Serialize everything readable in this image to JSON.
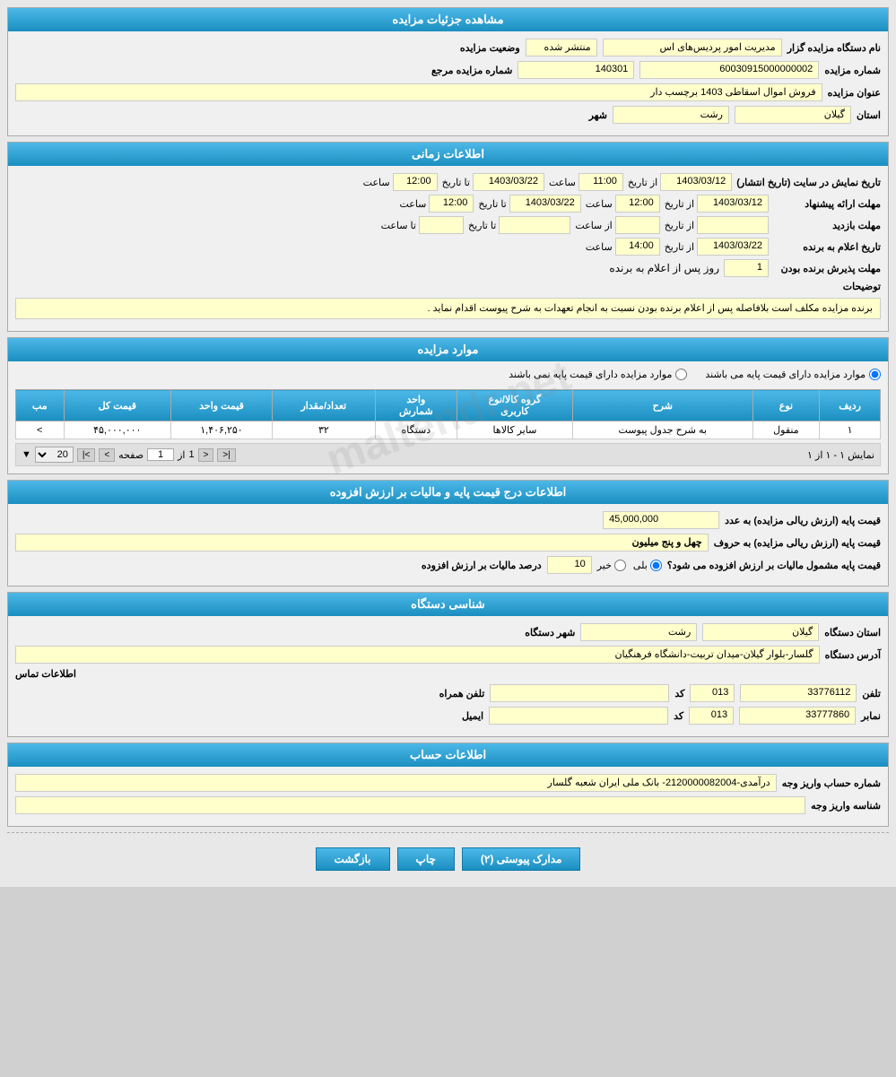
{
  "sections": {
    "auction_details": {
      "title": "مشاهده جزئیات مزایده",
      "fields": {
        "org_name_label": "نام دستگاه مزایده گزار",
        "org_name_value": "مدیریت امور پردیس‌های اس",
        "status_label": "وضعیت مزایده",
        "status_value": "منتشر شده",
        "auction_num_label": "شماره مزایده",
        "auction_num_value": "60030915000000002",
        "ref_num_label": "شماره مزایده مرجع",
        "ref_num_value": "140301",
        "title_label": "عنوان مزایده",
        "title_value": "فروش اموال اسقاطی 1403 برچسب دار",
        "province_label": "استان",
        "province_value": "گیلان",
        "city_label": "شهر",
        "city_value": "رشت"
      }
    },
    "time_info": {
      "title": "اطلاعات زمانی",
      "rows": [
        {
          "label": "تاریخ نمایش در سایت (تاریخ انتشار)",
          "from_date": "1403/03/12",
          "from_time": "11:00",
          "to_date": "1403/03/22",
          "to_time": "12:00"
        },
        {
          "label": "مهلت ارائه پیشنهاد",
          "from_date": "1403/03/12",
          "from_time": "12:00",
          "to_date": "1403/03/22",
          "to_time": "12:00"
        },
        {
          "label": "مهلت بازدید",
          "from_date": "",
          "from_time": "",
          "to_date": "",
          "to_time": ""
        },
        {
          "label": "تاریخ اعلام به برنده",
          "from_date": "1403/03/22",
          "from_time": "14:00",
          "to_date": "",
          "to_time": ""
        }
      ],
      "winner_days_label": "مهلت پذیرش برنده بودن",
      "winner_days_suffix": "روز پس از اعلام به برنده",
      "winner_days_value": "1",
      "desc_label": "توضیحات",
      "desc_value": "برنده مزایده مکلف است بلافاصله پس از اعلام برنده بودن نسبت به انجام تعهدات به شرح پیوست اقدام نماید ."
    },
    "moared": {
      "title": "موارد مزایده",
      "radio1": "موارد مزایده دارای قیمت پایه می باشند",
      "radio2": "موارد مزایده دارای قیمت پایه نمی باشند",
      "table": {
        "headers": [
          "ردیف",
          "نوع",
          "شرح",
          "گروه کالا/نوع کاربری",
          "واحد شمارش",
          "تعداد/مقدار",
          "قیمت واحد",
          "قیمت کل",
          "مبل"
        ],
        "rows": [
          {
            "row": "۱",
            "type": "منقول",
            "desc": "به شرح جدول پیوست",
            "group": "سایر کالاها",
            "unit": "دستگاه",
            "qty": "۳۲",
            "unit_price": "۱,۴۰۶,۲۵۰",
            "total": "۴۵,۰۰۰,۰۰۰",
            "extra": ">"
          }
        ]
      },
      "pager": {
        "show_label": "نمایش ۱ - ۱ از ۱",
        "page_label": "صفحه",
        "page_num": "1",
        "of_label": "از",
        "total_pages": "1",
        "per_page": "20"
      }
    },
    "price_info": {
      "title": "اطلاعات درج قیمت پایه و مالیات بر ارزش افزوده",
      "base_price_label": "قیمت پایه (ارزش ریالی مزایده) به عدد",
      "base_price_value": "45,000,000",
      "base_price_text_label": "قیمت پایه (ارزش ریالی مزایده) به حروف",
      "base_price_text_value": "چهل و پنج میلیون",
      "tax_question": "قیمت پایه مشمول مالیات بر ارزش افزوده می شود؟",
      "tax_yes": "بلی",
      "tax_no": "خیر",
      "tax_selected": "بلی",
      "tax_percent_label": "درصد مالیات بر ارزش افزوده",
      "tax_percent_value": "10"
    },
    "device_info": {
      "title": "شناسی دستگاه",
      "province_label": "استان دستگاه",
      "province_value": "گیلان",
      "city_label": "شهر دستگاه",
      "city_value": "رشت",
      "address_label": "آدرس دستگاه",
      "address_value": "گلسار-بلوار گیلان-میدان تربیت-دانشگاه فرهنگیان",
      "contact_label": "اطلاعات تماس",
      "phone_label": "تلفن",
      "phone_value": "33776112",
      "phone_code": "013",
      "fax_label": "نمابر",
      "fax_value": "33777860",
      "fax_code": "013",
      "mobile_label": "تلفن همراه",
      "mobile_value": "",
      "email_label": "ایمیل",
      "email_value": ""
    },
    "account_info": {
      "title": "اطلاعات حساب",
      "account_label": "شماره حساب واریز وجه",
      "account_value": "درآمدی-2120000082004- بانک ملی ایران شعبه گلسار",
      "owner_label": "شناسه واریز وجه",
      "owner_value": ""
    }
  },
  "buttons": {
    "docs": "مدارک پیوستی (۲)",
    "print": "چاپ",
    "back": "بازگشت"
  },
  "watermark": "maltendr.net"
}
